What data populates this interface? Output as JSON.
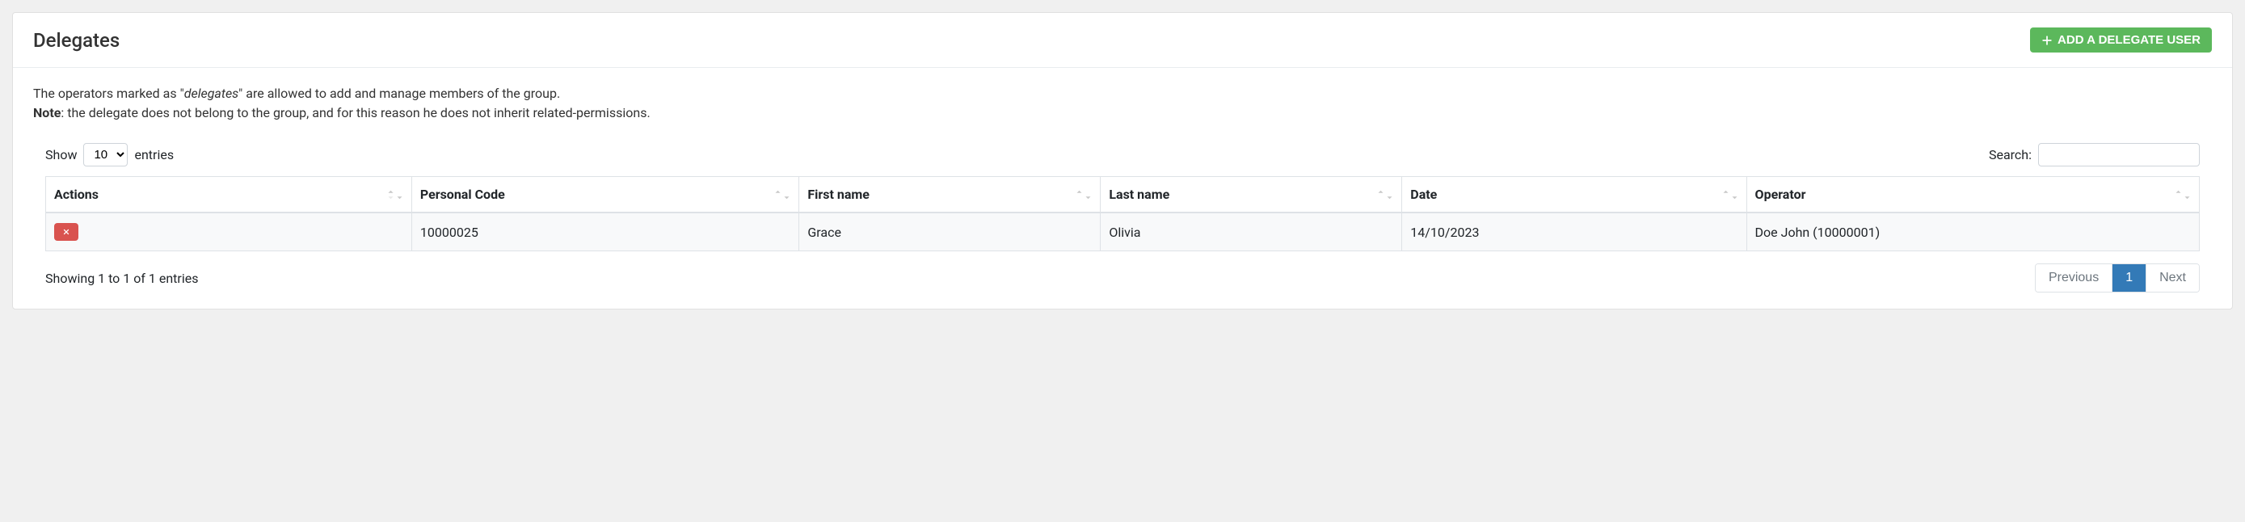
{
  "header": {
    "title": "Delegates",
    "add_button": "ADD A DELEGATE USER"
  },
  "description": {
    "text1_prefix": "The operators marked as \"",
    "text1_em": "delegates",
    "text1_suffix": "\" are allowed to add and manage members of the group.",
    "note_label": "Note",
    "note_text": ": the delegate does not belong to the group, and for this reason he does not inherit related-permissions."
  },
  "controls": {
    "show_label": "Show",
    "entries_label": "entries",
    "entries_value": "10",
    "search_label": "Search:"
  },
  "columns": {
    "actions": "Actions",
    "personal_code": "Personal Code",
    "first_name": "First name",
    "last_name": "Last name",
    "date": "Date",
    "operator": "Operator"
  },
  "rows": [
    {
      "personal_code": "10000025",
      "first_name": "Grace",
      "last_name": "Olivia",
      "date": "14/10/2023",
      "operator": "Doe John (10000001)"
    }
  ],
  "footer": {
    "info": "Showing 1 to 1 of 1 entries",
    "previous": "Previous",
    "page1": "1",
    "next": "Next"
  }
}
